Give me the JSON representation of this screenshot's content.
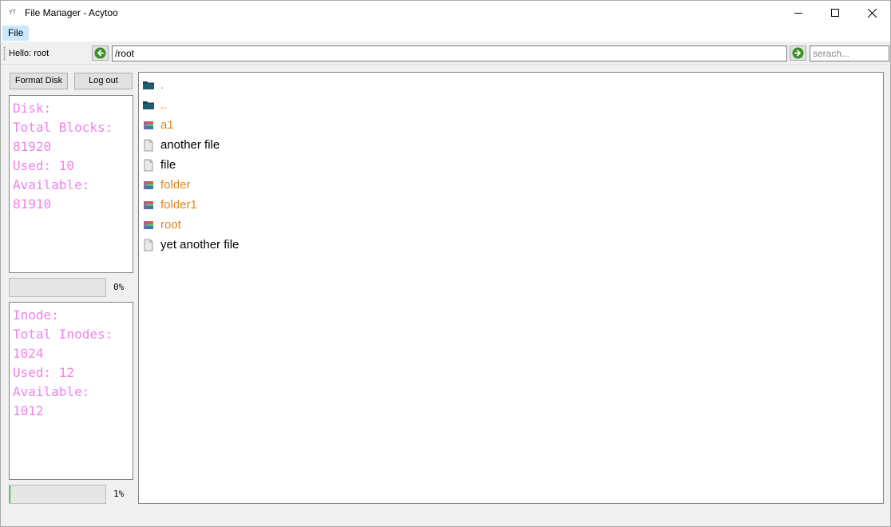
{
  "window": {
    "logo_text": "YT",
    "title": "File Manager - Acytoo"
  },
  "menu": {
    "items": [
      {
        "label": "File"
      }
    ]
  },
  "toolbar": {
    "hello_label": "Hello:",
    "username": "root",
    "path_value": "/root",
    "search_placeholder": "serach..."
  },
  "left_panel": {
    "format_button": "Format Disk",
    "logout_button": "Log out",
    "disk_info": {
      "title": "Disk:",
      "total_label": "Total Blocks:",
      "total_value": "81920",
      "used": "Used: 10",
      "available_label": "Available:",
      "available_value": "81910"
    },
    "disk_progress": {
      "percent": 0,
      "label": "0%"
    },
    "inode_info": {
      "title": "Inode:",
      "total_label": "Total Inodes:",
      "total_value": "1024",
      "used": "Used: 12",
      "available_label": "Available:",
      "available_value": "1012"
    },
    "inode_progress": {
      "percent": 1,
      "label": "1%"
    }
  },
  "files": [
    {
      "name": ".",
      "kind": "dir-dark"
    },
    {
      "name": "..",
      "kind": "dir-dark"
    },
    {
      "name": "a1",
      "kind": "dir"
    },
    {
      "name": "another file",
      "kind": "file"
    },
    {
      "name": "file",
      "kind": "file"
    },
    {
      "name": "folder",
      "kind": "dir"
    },
    {
      "name": "folder1",
      "kind": "dir"
    },
    {
      "name": "root",
      "kind": "dir"
    },
    {
      "name": "yet another file",
      "kind": "file"
    }
  ],
  "icons": {
    "dir-dark": "folder-dark-icon",
    "dir": "folder-color-icon",
    "file": "document-icon"
  },
  "colors": {
    "info_text": "#ee82ee",
    "directory_text": "#e0861d",
    "menu_highlight": "#cce8ff"
  }
}
